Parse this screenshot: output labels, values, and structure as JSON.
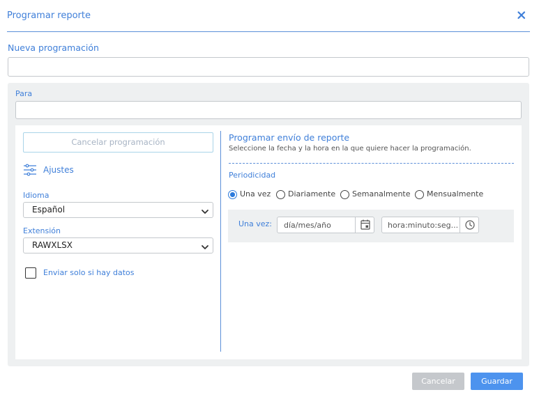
{
  "dialog": {
    "title": "Programar reporte",
    "close_icon": "close-icon"
  },
  "nueva_programacion": {
    "label": "Nueva programación",
    "value": ""
  },
  "para": {
    "label": "Para",
    "value": ""
  },
  "left": {
    "cancel_button": "Cancelar programación",
    "ajustes_label": "Ajustes",
    "ajustes_icon": "sliders-icon",
    "idioma_label": "Idioma",
    "idioma_value": "Español",
    "extension_label": "Extensión",
    "extension_value": "RAWXLSX",
    "checkbox_label": "Enviar solo si hay datos",
    "checkbox_checked": false
  },
  "right": {
    "title": "Programar envío de reporte",
    "subtitle": "Seleccione la fecha y la hora en la que quiere hacer la programación.",
    "periodicidad_label": "Periodicidad",
    "options": [
      {
        "label": "Una vez",
        "checked": true
      },
      {
        "label": "Diariamente",
        "checked": false
      },
      {
        "label": "Semanalmente",
        "checked": false
      },
      {
        "label": "Mensualmente",
        "checked": false
      }
    ],
    "una_vez_label": "Una vez:",
    "date_placeholder": "día/mes/año",
    "time_placeholder": "hora:minuto:seg..."
  },
  "footer": {
    "cancel_label": "Cancelar",
    "save_label": "Guardar"
  },
  "colors": {
    "accent": "#3f7fd9",
    "primary_button": "#4d93ee",
    "disabled_button": "#c5c8cc",
    "panel_bg": "#eef0f1"
  }
}
